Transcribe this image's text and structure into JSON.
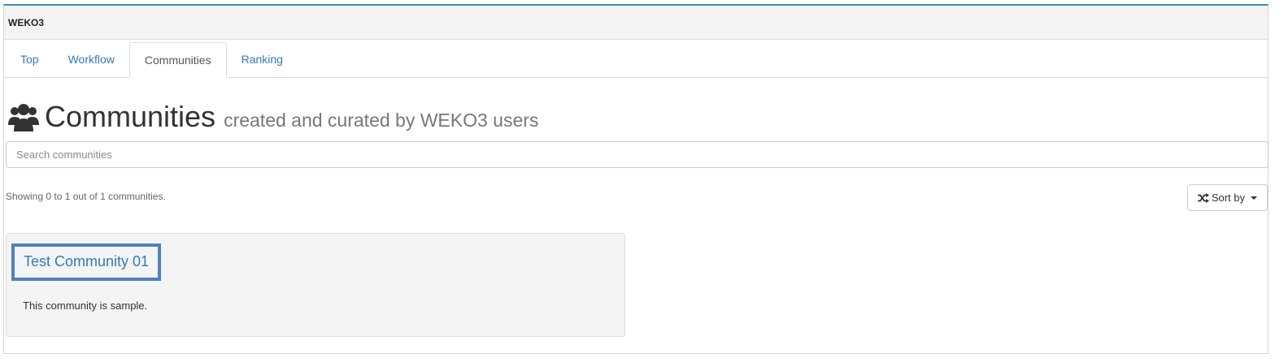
{
  "app": {
    "brand": "WEKO3"
  },
  "tabs": [
    {
      "label": "Top",
      "active": false
    },
    {
      "label": "Workflow",
      "active": false
    },
    {
      "label": "Communities",
      "active": true
    },
    {
      "label": "Ranking",
      "active": false
    }
  ],
  "page": {
    "icon": "users-icon",
    "title": "Communities",
    "subtitle": "created and curated by WEKO3 users"
  },
  "search": {
    "placeholder": "Search communities",
    "value": ""
  },
  "results": {
    "summary": "Showing 0 to 1 out of 1 communities."
  },
  "sort": {
    "label": "Sort by",
    "icon": "random-icon"
  },
  "communities": [
    {
      "title": "Test Community 01",
      "description": "This community is sample."
    }
  ],
  "colors": {
    "link": "#337ab7",
    "highlight_border": "#4f81bd",
    "panel_bg": "#f4f4f4"
  }
}
